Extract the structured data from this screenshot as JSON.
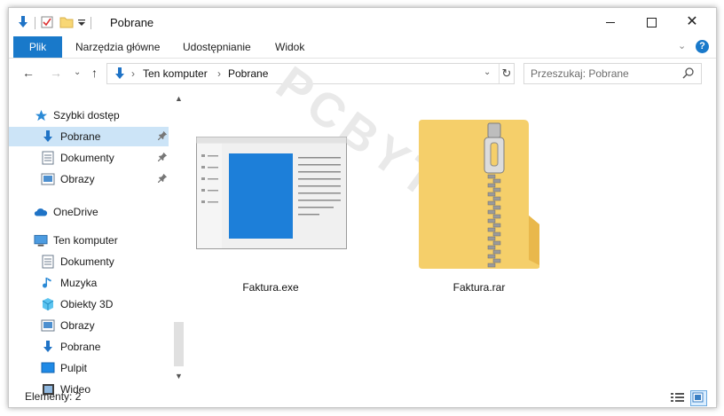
{
  "window": {
    "title": "Pobrane",
    "accent_color": "#1979ca"
  },
  "quick_access_toolbar": {
    "icons": [
      "download-arrow-icon",
      "properties-icon",
      "new-folder-icon",
      "customize-dropdown-icon"
    ]
  },
  "ribbon": {
    "file_tab": "Plik",
    "tabs": [
      "Narzędzia główne",
      "Udostępnianie",
      "Widok"
    ],
    "help": "?"
  },
  "address_bar": {
    "crumbs": [
      "Ten komputer",
      "Pobrane"
    ],
    "separator": "›"
  },
  "search": {
    "placeholder": "Przeszukaj: Pobrane"
  },
  "nav_pane": {
    "items": [
      {
        "label": "Szybki dostęp",
        "icon": "star-icon",
        "level": 0
      },
      {
        "label": "Pobrane",
        "icon": "download-folder-icon",
        "level": 1,
        "selected": true,
        "pinned": true
      },
      {
        "label": "Dokumenty",
        "icon": "documents-icon",
        "level": 1,
        "pinned": true
      },
      {
        "label": "Obrazy",
        "icon": "pictures-icon",
        "level": 1,
        "pinned": true
      },
      {
        "label": "OneDrive",
        "icon": "cloud-icon",
        "level": 0
      },
      {
        "label": "Ten komputer",
        "icon": "computer-icon",
        "level": 0
      },
      {
        "label": "Dokumenty",
        "icon": "documents-icon",
        "level": 1
      },
      {
        "label": "Muzyka",
        "icon": "music-icon",
        "level": 1
      },
      {
        "label": "Obiekty 3D",
        "icon": "cube-3d-icon",
        "level": 1
      },
      {
        "label": "Obrazy",
        "icon": "pictures-icon",
        "level": 1
      },
      {
        "label": "Pobrane",
        "icon": "download-folder-icon",
        "level": 1
      },
      {
        "label": "Pulpit",
        "icon": "desktop-icon",
        "level": 1
      },
      {
        "label": "Wideo",
        "icon": "video-icon",
        "level": 1
      }
    ]
  },
  "files": [
    {
      "name": "Faktura.exe",
      "icon": "application-window-icon"
    },
    {
      "name": "Faktura.rar",
      "icon": "zip-folder-icon"
    }
  ],
  "watermark": "PCBYTES",
  "status_bar": {
    "items_count": "Elementy: 2"
  }
}
